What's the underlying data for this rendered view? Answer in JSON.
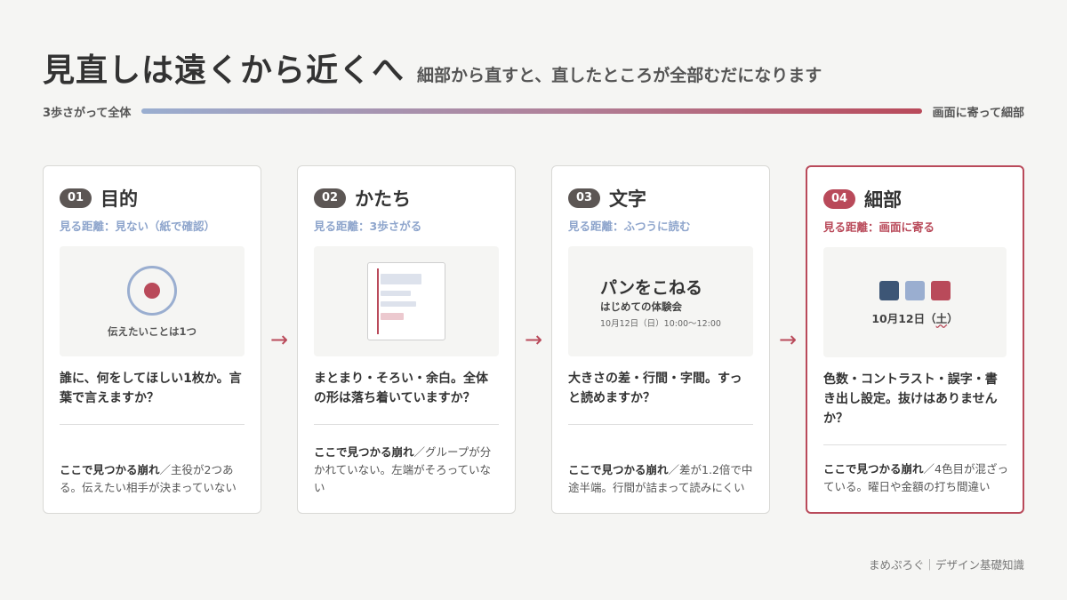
{
  "header": {
    "title": "見直しは遠くから近くへ",
    "subtitle": "細部から直すと、直したところが全部むだになります"
  },
  "scale": {
    "left_label": "3歩さがって全体",
    "right_label": "画面に寄って細部",
    "gradient_start": "#9aaed0",
    "gradient_end": "#b94a5a"
  },
  "arrow_glyph": "→",
  "cards": [
    {
      "number": "01",
      "title": "目的",
      "distance": "見る距離：見ない（紙で確認）",
      "visual_label": "伝えたいことは1つ",
      "description": "誰に、何をしてほしい1枚か。言葉で言えますか？",
      "finding_label": "ここで見つかる崩れ",
      "finding_text": "／主役が2つある。伝えたい相手が決まっていない"
    },
    {
      "number": "02",
      "title": "かたち",
      "distance": "見る距離：3歩さがる",
      "description": "まとまり・そろい・余白。全体の形は落ち着いていますか？",
      "finding_label": "ここで見つかる崩れ",
      "finding_text": "／グループが分かれていない。左端がそろっていない"
    },
    {
      "number": "03",
      "title": "文字",
      "distance": "見る距離：ふつうに読む",
      "visual_title": "パンをこねる",
      "visual_sub": "はじめての体験会",
      "visual_date": "10月12日（日）10:00〜12:00",
      "description": "大きさの差・行間・字間。すっと読めますか？",
      "finding_label": "ここで見つかる崩れ",
      "finding_text": "／差が1.2倍で中途半端。行間が詰まって読みにくい"
    },
    {
      "number": "04",
      "title": "細部",
      "distance": "見る距離：画面に寄る",
      "visual_date_main": "10月12日（",
      "visual_date_day": "土",
      "visual_date_end": "）",
      "swatches": [
        "#3d5676",
        "#9aaed0",
        "#b94a5a"
      ],
      "description": "色数・コントラスト・誤字・書き出し設定。抜けはありませんか？",
      "finding_label": "ここで見つかる崩れ",
      "finding_text": "／4色目が混ざっている。曜日や金額の打ち間違い"
    }
  ],
  "footer": "まめぷろぐ｜デザイン基礎知識"
}
